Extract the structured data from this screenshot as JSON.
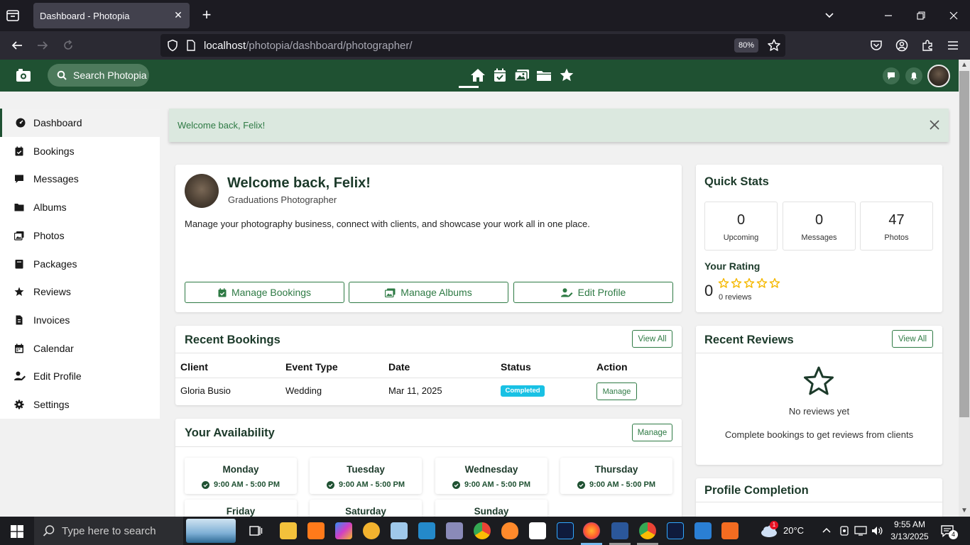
{
  "browser": {
    "tab_title": "Dashboard - Photopia",
    "url_host": "localhost",
    "url_path": "/photopia/dashboard/photographer/",
    "zoom": "80%"
  },
  "app": {
    "search_label": "Search Photopia",
    "brand_color": "#1f5132"
  },
  "sidebar": {
    "items": [
      {
        "label": "Dashboard",
        "icon": "dashboard-gauge-icon"
      },
      {
        "label": "Bookings",
        "icon": "calendar-check-icon"
      },
      {
        "label": "Messages",
        "icon": "chat-bubble-icon"
      },
      {
        "label": "Albums",
        "icon": "folder-icon"
      },
      {
        "label": "Photos",
        "icon": "images-icon"
      },
      {
        "label": "Packages",
        "icon": "box-icon"
      },
      {
        "label": "Reviews",
        "icon": "star-icon"
      },
      {
        "label": "Invoices",
        "icon": "invoice-icon"
      },
      {
        "label": "Calendar",
        "icon": "calendar-icon"
      },
      {
        "label": "Edit Profile",
        "icon": "user-edit-icon"
      },
      {
        "label": "Settings",
        "icon": "gear-icon"
      }
    ]
  },
  "alert": {
    "text": "Welcome back, Felix!"
  },
  "welcome": {
    "title": "Welcome back, Felix!",
    "subtitle": "Graduations Photographer",
    "description": "Manage your photography business, connect with clients, and showcase your work all in one place.",
    "buttons": [
      "Manage Bookings",
      "Manage Albums",
      "Edit Profile"
    ]
  },
  "quick_stats": {
    "title": "Quick Stats",
    "stats": [
      {
        "value": "0",
        "label": "Upcoming"
      },
      {
        "value": "0",
        "label": "Messages"
      },
      {
        "value": "47",
        "label": "Photos"
      }
    ],
    "rating_title": "Your Rating",
    "rating_value": "0",
    "stars_filled": 0,
    "reviews_text": "0 reviews"
  },
  "recent_bookings": {
    "title": "Recent Bookings",
    "view_all": "View All",
    "columns": [
      "Client",
      "Event Type",
      "Date",
      "Status",
      "Action"
    ],
    "rows": [
      {
        "client": "Gloria Busio",
        "event": "Wedding",
        "date": "Mar 11, 2025",
        "status": "Completed",
        "action": "Manage"
      }
    ]
  },
  "recent_reviews": {
    "title": "Recent Reviews",
    "view_all": "View All",
    "empty_title": "No reviews yet",
    "empty_desc": "Complete bookings to get reviews from clients"
  },
  "availability": {
    "title": "Your Availability",
    "manage": "Manage",
    "days": [
      {
        "day": "Monday",
        "time": "9:00 AM - 5:00 PM"
      },
      {
        "day": "Tuesday",
        "time": "9:00 AM - 5:00 PM"
      },
      {
        "day": "Wednesday",
        "time": "9:00 AM - 5:00 PM"
      },
      {
        "day": "Thursday",
        "time": "9:00 AM - 5:00 PM"
      },
      {
        "day": "Friday"
      },
      {
        "day": "Saturday"
      },
      {
        "day": "Sunday"
      }
    ]
  },
  "profile_completion": {
    "title": "Profile Completion"
  },
  "taskbar": {
    "search_placeholder": "Type here to search",
    "weather": "20°C",
    "time": "9:55 AM",
    "date": "3/13/2025",
    "notification_count": "4",
    "badge_count": "1"
  }
}
